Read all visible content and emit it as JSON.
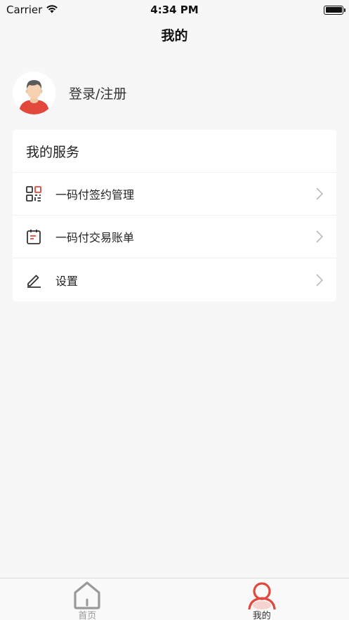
{
  "status_bar": {
    "carrier": "Carrier",
    "time": "4:34 PM"
  },
  "nav": {
    "title": "我的"
  },
  "profile": {
    "login_label": "登录/注册"
  },
  "services": {
    "header": "我的服务",
    "items": [
      {
        "label": "一码付签约管理",
        "icon": "qr-code-icon"
      },
      {
        "label": "一码付交易账单",
        "icon": "calendar-bill-icon"
      },
      {
        "label": "设置",
        "icon": "edit-pen-icon"
      }
    ]
  },
  "tabbar": {
    "tabs": [
      {
        "label": "首页",
        "icon": "home-icon",
        "active": false
      },
      {
        "label": "我的",
        "icon": "user-icon",
        "active": true
      }
    ]
  },
  "colors": {
    "accent": "#e2483c",
    "inactive": "#999999",
    "background": "#f7f7f7"
  }
}
